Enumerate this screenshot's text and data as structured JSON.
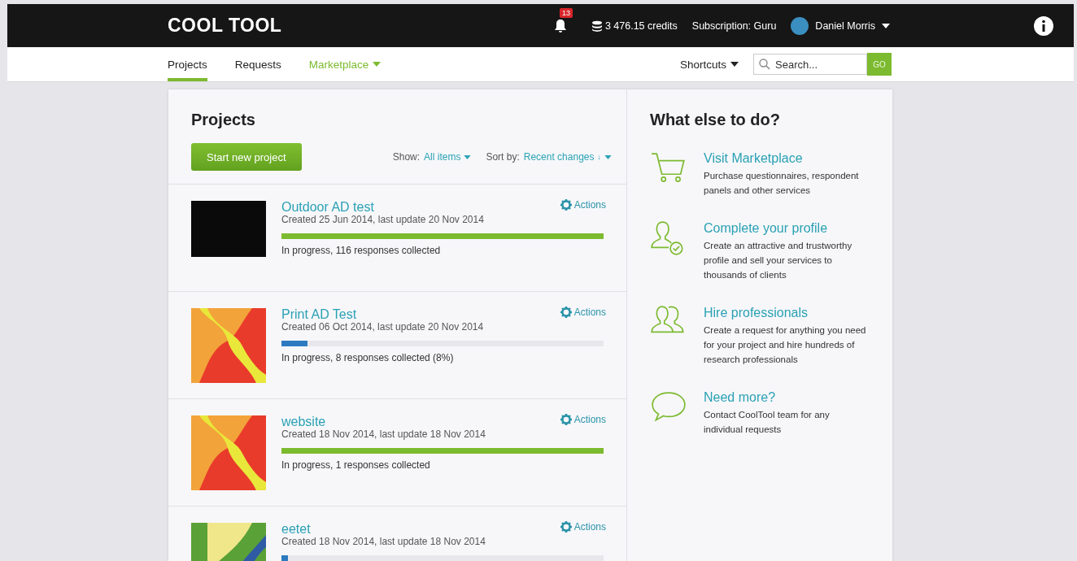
{
  "header": {
    "logo": "COOL TOOL",
    "notifications": "13",
    "credits": "3 476.15 credits",
    "subscription": "Subscription: Guru",
    "user": "Daniel Morris"
  },
  "nav": {
    "tabs": [
      {
        "label": "Projects",
        "selected": true,
        "kind": "link"
      },
      {
        "label": "Requests",
        "selected": false,
        "kind": "link"
      },
      {
        "label": "Marketplace",
        "selected": false,
        "kind": "dropdown"
      }
    ],
    "shortcuts": "Shortcuts",
    "search": {
      "placeholder": "Search...",
      "button": "GO"
    }
  },
  "projects": {
    "title": "Projects",
    "new_button": "Start new project",
    "show_label": "Show:",
    "show_value": "All items",
    "sort_label": "Sort by:",
    "sort_value": "Recent changes",
    "sort_arrow": "↓",
    "items": [
      {
        "name": "Outdoor AD test",
        "kind": "photo",
        "dates": "Created 25 Jun 2014, last update 20 Nov 2014",
        "level": 1,
        "status": "In progress, 116 responses collected",
        "actions": "Actions"
      },
      {
        "name": "Print AD Test",
        "kind": "orange",
        "dates": "Created 06 Oct 2014, last update 20 Nov 2014",
        "level": 0.08,
        "status": "In progress, 8 responses collected (8%)",
        "actions": "Actions"
      },
      {
        "name": "website",
        "kind": "orange",
        "dates": "Created 18 Nov 2014, last update 18 Nov 2014",
        "level": 1,
        "status": "In progress, 1 responses collected",
        "actions": "Actions"
      },
      {
        "name": "eetet",
        "kind": "green",
        "dates": "Created 18 Nov 2014, last update 18 Nov 2014",
        "level": 0.02,
        "actions": "Actions"
      }
    ]
  },
  "sidebar": {
    "title": "What else to do?",
    "items": [
      {
        "kind": "cart",
        "title": "Visit Marketplace",
        "text": "Purchase questionnaires, respondent panels and other services"
      },
      {
        "kind": "profile",
        "title": "Complete your profile",
        "text": "Create an attractive and trustworthy profile and sell your services to thousands of clients"
      },
      {
        "kind": "people",
        "title": "Hire professionals",
        "text": "Create a request for anything you need for your project and hire hundreds of research professionals"
      },
      {
        "kind": "chat",
        "title": "Need more?",
        "text": "Contact CoolTool team for any individual requests"
      }
    ]
  }
}
